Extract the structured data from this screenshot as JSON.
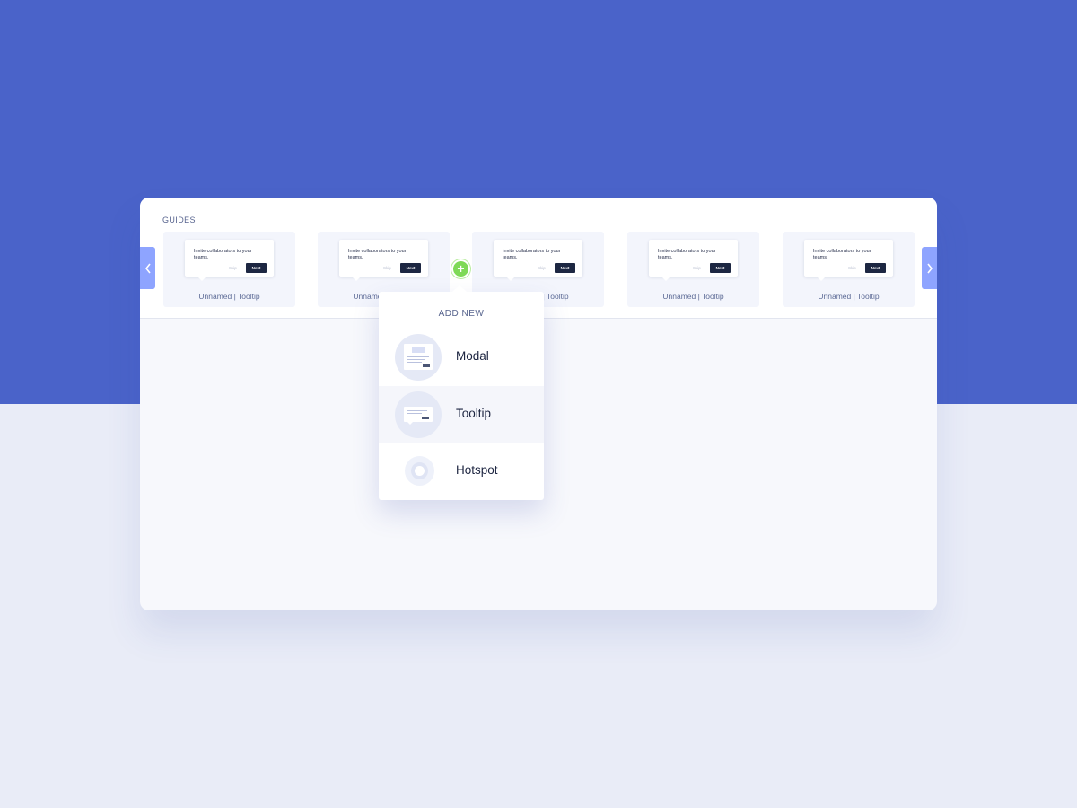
{
  "section_label": "GUIDES",
  "cards": [
    {
      "tip_text": "Invite collaborators to your teams.",
      "skip_label": "Skip",
      "next_label": "Next",
      "label": "Unnamed | Tooltip"
    },
    {
      "tip_text": "Invite collaborators to your teams.",
      "skip_label": "Skip",
      "next_label": "Next",
      "label": "Unnamed | Tooltip"
    },
    {
      "tip_text": "Invite collaborators to your teams.",
      "skip_label": "Skip",
      "next_label": "Next",
      "label": "Unnamed | Tooltip"
    },
    {
      "tip_text": "Invite collaborators to your teams.",
      "skip_label": "Skip",
      "next_label": "Next",
      "label": "Unnamed | Tooltip"
    },
    {
      "tip_text": "Invite collaborators to your teams.",
      "skip_label": "Skip",
      "next_label": "Next",
      "label": "Unnamed | Tooltip"
    }
  ],
  "nav": {
    "prev_icon": "chevron-left-icon",
    "next_icon": "chevron-right-icon"
  },
  "add_button": {
    "icon": "plus-icon",
    "glyph": "+"
  },
  "add_menu": {
    "title": "ADD NEW",
    "items": [
      {
        "label": "Modal",
        "icon": "modal-icon"
      },
      {
        "label": "Tooltip",
        "icon": "tooltip-icon",
        "highlighted": true
      },
      {
        "label": "Hotspot",
        "icon": "hotspot-icon"
      }
    ]
  },
  "colors": {
    "brand_blue": "#4a63c9",
    "arrow_blue": "#8ea4ff",
    "add_green": "#7ed957",
    "dark_button": "#1d2742"
  }
}
